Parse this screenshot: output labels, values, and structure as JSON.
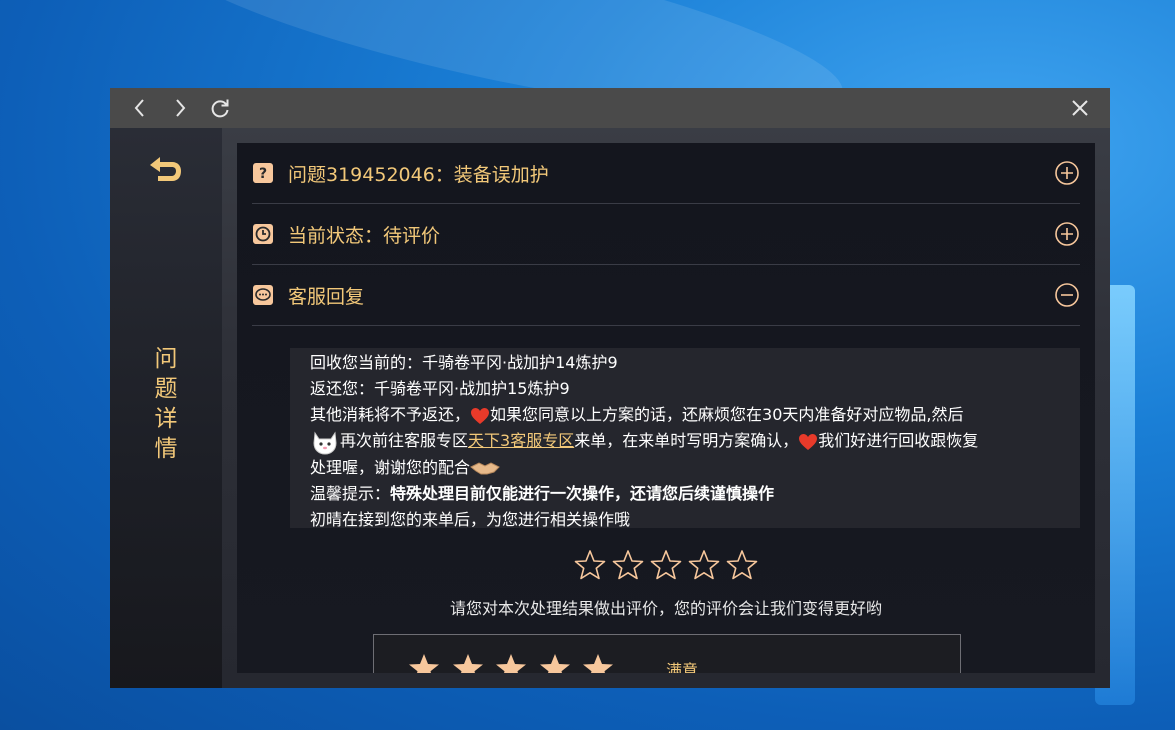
{
  "window": {
    "nav": {
      "back_icon": "chevron-left-icon",
      "forward_icon": "chevron-right-icon",
      "refresh_icon": "refresh-icon",
      "close_icon": "close-icon"
    }
  },
  "sidebar": {
    "back_icon": "return-arrow-icon",
    "title_chars": [
      "问",
      "题",
      "详",
      "情"
    ]
  },
  "sections": [
    {
      "icon": "question-icon",
      "label": "问题319452046：装备误加护",
      "toggle": "plus-circle-icon",
      "expanded": false
    },
    {
      "icon": "clock-icon",
      "label": "当前状态：待评价",
      "toggle": "plus-circle-icon",
      "expanded": false
    },
    {
      "icon": "chat-bubble-icon",
      "label": "客服回复",
      "toggle": "minus-circle-icon",
      "expanded": true
    }
  ],
  "reply": {
    "line1": "回收您当前的：千骑卷平冈·战加护14炼护9",
    "line2": "返还您：千骑卷平冈·战加护15炼护9",
    "line3a": "其他消耗将不予返还，",
    "line3b": "如果您同意以上方案的话，还麻烦您在30天内准备好对应物品,然后",
    "line4a": "再次前往客服专区",
    "line4_link": "天下3客服专区",
    "line4b": "来单，在来单时写明方案确认，",
    "line4c": "我们好进行回收跟恢复",
    "line5": "处理喔，谢谢您的配合",
    "line6a": "温馨提示：",
    "line6b": "特殊处理目前仅能进行一次操作，还请您后续谨慎操作",
    "line7": "初晴在接到您的来单后，为您进行相关操作哦"
  },
  "rating": {
    "star_count": 5,
    "prompt": "请您对本次处理结果做出评价，您的评价会让我们变得更好哟",
    "option": {
      "stars": 5,
      "label": "满意"
    }
  },
  "colors": {
    "accent": "#f2c879",
    "star_fill": "#f7c79c",
    "titlebar": "#4a4a4a"
  }
}
